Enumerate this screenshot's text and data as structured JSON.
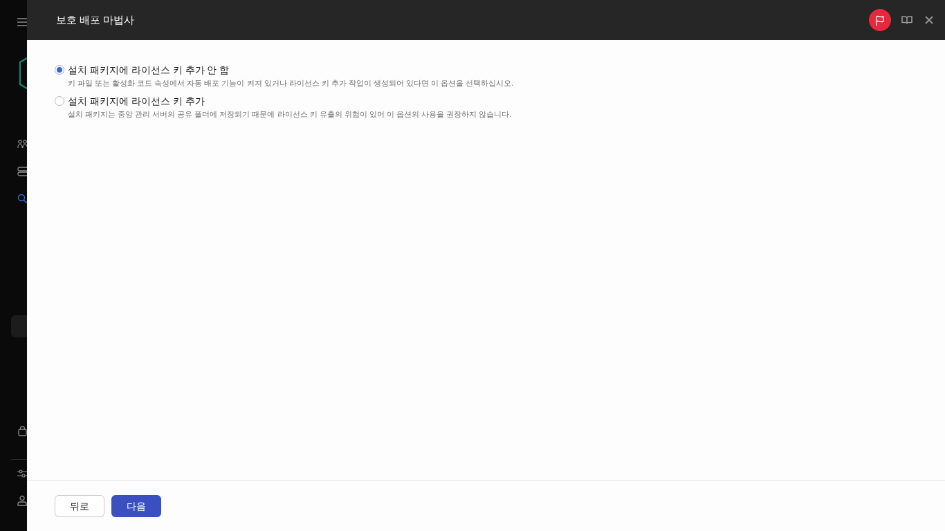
{
  "window": {
    "title": "보호 배포 마법사"
  },
  "options": [
    {
      "label": "설치 패키지에 라이선스 키 추가 안 함",
      "description": "키 파일 또는 활성화 코드 속성에서 자동 배포 기능이 켜져 있거나 라이선스 키 추가 작업이 생성되어 있다면 이 옵션을 선택하십시오.",
      "selected": true
    },
    {
      "label": "설치 패키지에 라이선스 키 추가",
      "description": "설치 패키지는 중앙 관리 서버의 공유 폴더에 저장되기 때문에 라이선스 키 유출의 위험이 있어 이 옵션의 사용을 권장하지 않습니다.",
      "selected": false
    }
  ],
  "buttons": [
    {
      "label": "뒤로",
      "kind": "secondary"
    },
    {
      "label": "다음",
      "kind": "primary"
    }
  ]
}
